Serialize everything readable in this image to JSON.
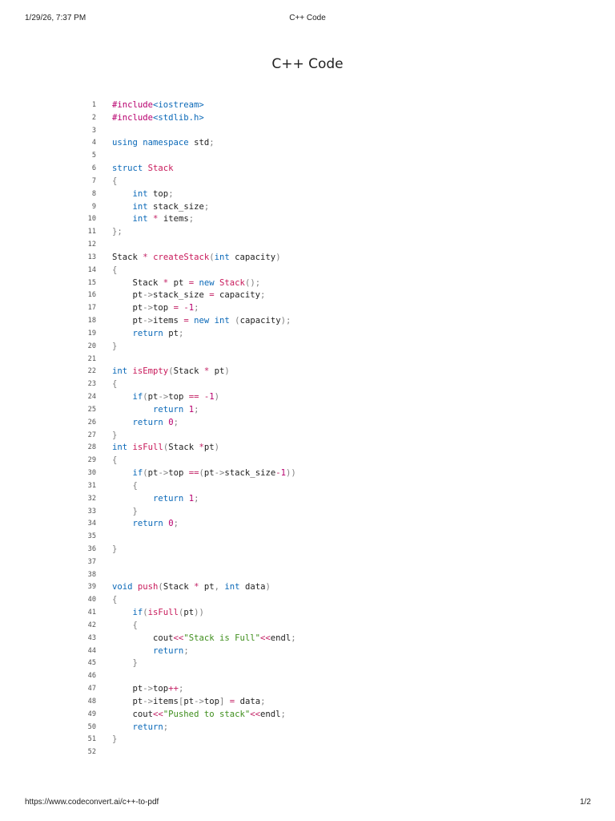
{
  "header": {
    "datetime": "1/29/26, 7:37 PM",
    "title": "C++ Code"
  },
  "document": {
    "title": "C++ Code"
  },
  "code": {
    "language": "C++",
    "colors": {
      "keyword": "#0b69b8",
      "preprocessor": "#b8006e",
      "function_name": "#c8195a",
      "operator": "#c21f63",
      "string": "#3e8e1c",
      "number": "#b8006e",
      "punctuation": "#808080"
    },
    "lines": [
      "#include<iostream>",
      "#include<stdlib.h>",
      "",
      "using namespace std;",
      "",
      "struct Stack",
      "{",
      "    int top;",
      "    int stack_size;",
      "    int * items;",
      "};",
      "",
      "Stack * createStack(int capacity)",
      "{",
      "    Stack * pt = new Stack();",
      "    pt->stack_size = capacity;",
      "    pt->top = -1;",
      "    pt->items = new int (capacity);",
      "    return pt;",
      "}",
      "",
      "int isEmpty(Stack * pt)",
      "{",
      "    if(pt->top == -1)",
      "        return 1;",
      "    return 0;",
      "}",
      "int isFull(Stack *pt)",
      "{",
      "    if(pt->top ==(pt->stack_size-1))",
      "    {",
      "        return 1;",
      "    }",
      "    return 0;",
      "",
      "}",
      "",
      "",
      "void push(Stack * pt, int data)",
      "{",
      "    if(isFull(pt))",
      "    {",
      "        cout<<\"Stack is Full\"<<endl;",
      "        return;",
      "    }",
      "",
      "    pt->top++;",
      "    pt->items[pt->top] = data;",
      "    cout<<\"Pushed to stack\"<<endl;",
      "    return;",
      "}",
      ""
    ]
  },
  "footer": {
    "url": "https://www.codeconvert.ai/c++-to-pdf",
    "page": "1/2"
  }
}
